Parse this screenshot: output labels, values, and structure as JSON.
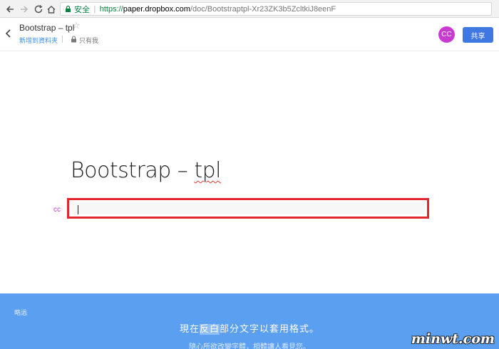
{
  "browser": {
    "secure_label": "安全",
    "url_scheme": "https://",
    "url_host": "paper.dropbox.com",
    "url_path": "/doc/Bootstraptpl-Xr23ZK3b5ZcltkiJ8eenF",
    "icons": [
      "back-arrow-icon",
      "forward-arrow-icon",
      "reload-icon",
      "home-icon",
      "lock-icon"
    ]
  },
  "header": {
    "doc_title": "Bootstrap – tpl",
    "star_icon": "☆",
    "add_to_folder": "新增到資料夾",
    "visibility": "只有我",
    "avatar_initials": "CC",
    "share_label": "共享",
    "colors": {
      "avatar": "#c93bd0",
      "share": "#3f78e0",
      "link": "#3d8ce0"
    }
  },
  "document": {
    "heading_prefix": "Bootstrap – ",
    "heading_misspelled": "tpl",
    "author_tag": "cc",
    "input_value": ""
  },
  "onboarding": {
    "skip_label": "略過",
    "hint_before": "現在",
    "hint_highlight": "反白",
    "hint_after": "部分文字以套用格式。",
    "hint_sub": "隨心所欲改變字體，相體讓人看見您。",
    "background": "#5a9ff0"
  },
  "watermark": "minwt.com"
}
